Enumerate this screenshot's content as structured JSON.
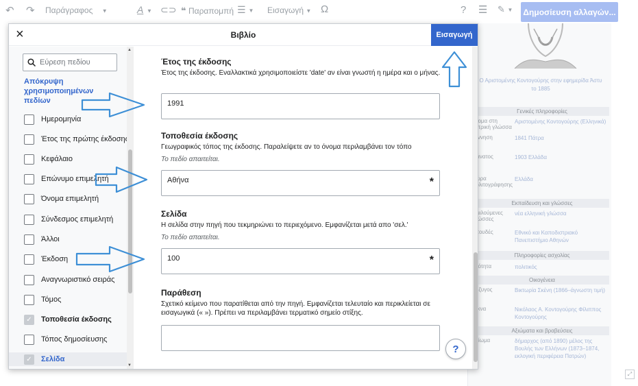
{
  "toolbar": {
    "paragraph": "Παράγραφος",
    "cite": "Παραπομπή",
    "insert": "Εισαγωγή",
    "help": "?",
    "publish": "Δημοσίευση αλλαγών..."
  },
  "dialog": {
    "title": "Βιβλίο",
    "close": "×",
    "insert_button": "Εισαγωγή"
  },
  "sidebar": {
    "search_placeholder": "Εύρεση πεδίου",
    "hide_link": "Απόκρυψη χρησιμοποιημένων πεδίων",
    "items": [
      {
        "label": "Ημερομηνία",
        "checked": false
      },
      {
        "label": "Έτος της πρώτης έκδοσης",
        "checked": false
      },
      {
        "label": "Κεφάλαιο",
        "checked": false
      },
      {
        "label": "Επώνυμο επιμελητή",
        "checked": false
      },
      {
        "label": "Όνομα επιμελητή",
        "checked": false
      },
      {
        "label": "Σύνδεσμος επιμελητή",
        "checked": false
      },
      {
        "label": "Άλλοι",
        "checked": false
      },
      {
        "label": "Έκδοση",
        "checked": false
      },
      {
        "label": "Αναγνωριστικό σειράς",
        "checked": false
      },
      {
        "label": "Τόμος",
        "checked": false
      },
      {
        "label": "Τοποθεσία έκδοσης",
        "checked": true
      },
      {
        "label": "Τόπος δημοσίευσης",
        "checked": false
      },
      {
        "label": "Σελίδα",
        "checked": true
      }
    ]
  },
  "fields": {
    "year": {
      "label": "Έτος της έκδοσης",
      "desc": "Έτος της έκδοσης. Εναλλακτικά χρησιμοποιείστε 'date' αν είναι γνωστή η ημέρα και ο μήνας.",
      "value": "1991"
    },
    "location": {
      "label": "Τοποθεσία έκδοσης",
      "desc": "Γεωγραφικός τόπος της έκδοσης. Παραλείψετε αν το όνομα περιλαμβάνει τον τόπο",
      "required": "Το πεδίο απαιτείται.",
      "value": "Αθήνα"
    },
    "page": {
      "label": "Σελίδα",
      "desc": "Η σελίδα στην πηγή που τεκμηριώνει το περιεχόμενο. Εμφανίζεται μετά απο 'σελ.'",
      "required": "Το πεδίο απαιτείται.",
      "value": "100"
    },
    "quote": {
      "label": "Παράθεση",
      "desc": "Σχετικό κείμενο που παρατίθεται από την πηγή. Εμφανίζεται τελευταίο και περικλείεται σε εισαγωγικά (« »). Πρέπει να περιλαμβάνει τερματικό σημείο στίξης.",
      "value": ""
    },
    "required_mark": "*"
  },
  "help_button": "?",
  "infobox": {
    "caption": "Ο Αριστομένης Κοντογούρης στην εφημερίδα Άστυ το 1885",
    "general_header": "Γενικές πληροφορίες",
    "rows1": [
      {
        "k": "όνομα στη μητρική γλώσσα",
        "v": "Αριστομένης Κοντογούρης (Ελληνικά)"
      },
      {
        "k": "Γέννηση",
        "v": "1841 Πάτρα"
      },
      {
        "k": "Θάνατος",
        "v": "1903 Ελλάδα"
      },
      {
        "k": "Χώρα πολιτογράφησης",
        "v": "Ελλάδα"
      }
    ],
    "education_header": "Εκπαίδευση και γλώσσες",
    "rows2": [
      {
        "k": "Ομιλούμενες γλώσσες",
        "v": "νέα ελληνική γλώσσα"
      },
      {
        "k": "Σπουδές",
        "v": "Εθνικό και Καποδιστριακό Πανεπιστήμιο Αθηνών"
      }
    ],
    "work_header": "Πληροφορίες ασχολίας",
    "rows3": [
      {
        "k": "Ιδιότητα",
        "v": "πολιτικός"
      }
    ],
    "family_header": "Οικογένεια",
    "rows4": [
      {
        "k": "Σύζυγος",
        "v": "Βικτωρία Σκένη (1866–άγνωστη τιμή)"
      },
      {
        "k": "Τέκνα",
        "v": "Νικόλαος Α. Κοντογούρης Φίλιππος Κοντογούρης"
      }
    ],
    "awards_header": "Αξιώματα και βραβεύσεις",
    "rows5": [
      {
        "k": "Αξίωμα",
        "v": "δήμαρχος (από 1890) μέλος της Βουλής των Ελλήνων (1873–1874, εκλογική περιφέρεια Πατρών)"
      }
    ]
  }
}
